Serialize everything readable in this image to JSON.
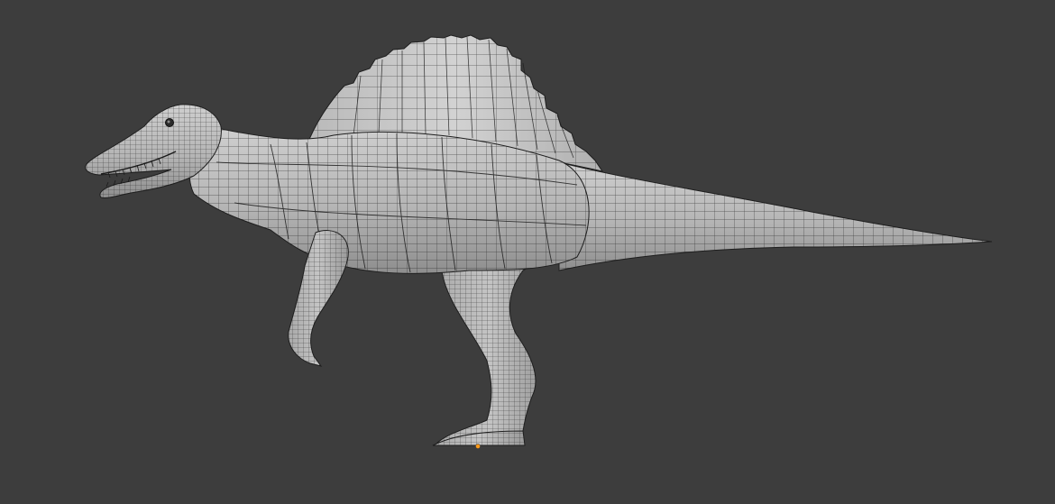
{
  "viewport": {
    "background": "#3d3d3d",
    "mesh_color": "#b8b8b8",
    "wire_color": "#1e1e1e",
    "origin_color": "#ff9a1a",
    "display_mode": "solid-with-wireframe",
    "object_origin_icon": "origin-point-icon"
  }
}
